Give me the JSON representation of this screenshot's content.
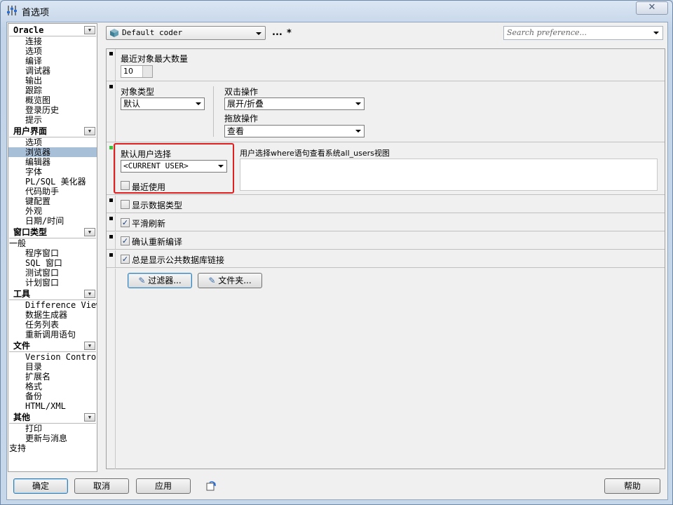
{
  "window": {
    "title": "首选项",
    "close_label": "✕"
  },
  "sidebar": {
    "sections": [
      {
        "title": "Oracle",
        "items": [
          "连接",
          "选项",
          "编译",
          "调试器",
          "输出",
          "跟踪",
          "概览图",
          "登录历史",
          "提示"
        ]
      },
      {
        "title": "用户界面",
        "items": [
          "选项",
          "浏览器",
          "编辑器",
          "字体",
          "PL/SQL 美化器",
          "代码助手",
          "键配置",
          "外观",
          "日期/时间"
        ],
        "selected": "浏览器"
      },
      {
        "title": "窗口类型",
        "items": [
          "一般",
          "程序窗口",
          "SQL 窗口",
          "测试窗口",
          "计划窗口"
        ]
      },
      {
        "title": "工具",
        "items": [
          "Difference Viewer",
          "数据生成器",
          "任务列表",
          "重新调用语句"
        ]
      },
      {
        "title": "文件",
        "items": [
          "Version Control",
          "目录",
          "扩展名",
          "格式",
          "备份",
          "HTML/XML"
        ]
      },
      {
        "title": "其他",
        "items": [
          "打印",
          "更新与消息",
          "支持"
        ]
      }
    ]
  },
  "toolbar": {
    "profile": "Default coder",
    "more": "...",
    "modified": "*",
    "search_placeholder": "Search preference..."
  },
  "settings": {
    "recent_max_label": "最近对象最大数量",
    "recent_max_value": "10",
    "object_type_label": "对象类型",
    "object_type_value": "默认",
    "double_click_label": "双击操作",
    "double_click_value": "展开/折叠",
    "drag_label": "拖放操作",
    "drag_value": "查看",
    "default_user_label": "默认用户选择",
    "default_user_value": "<CURRENT USER>",
    "recent_use_label": "最近使用",
    "desc_label": "用户选择where语句查看系统all_users视图",
    "show_datatype_label": "显示数据类型",
    "smooth_refresh_label": "平滑刷新",
    "confirm_recompile_label": "确认重新编译",
    "public_dblink_label": "总是显示公共数据库链接",
    "filter_button": "过滤器...",
    "folder_button": "文件夹..."
  },
  "checkbox_states": {
    "recent_use": false,
    "show_datatype": false,
    "smooth_refresh": true,
    "confirm_recompile": true,
    "public_dblink": true
  },
  "footer": {
    "ok": "确定",
    "cancel": "取消",
    "apply": "应用",
    "help": "帮助"
  },
  "colors": {
    "highlight_box": "#e02020",
    "selected_item": "#a8bfd8"
  }
}
